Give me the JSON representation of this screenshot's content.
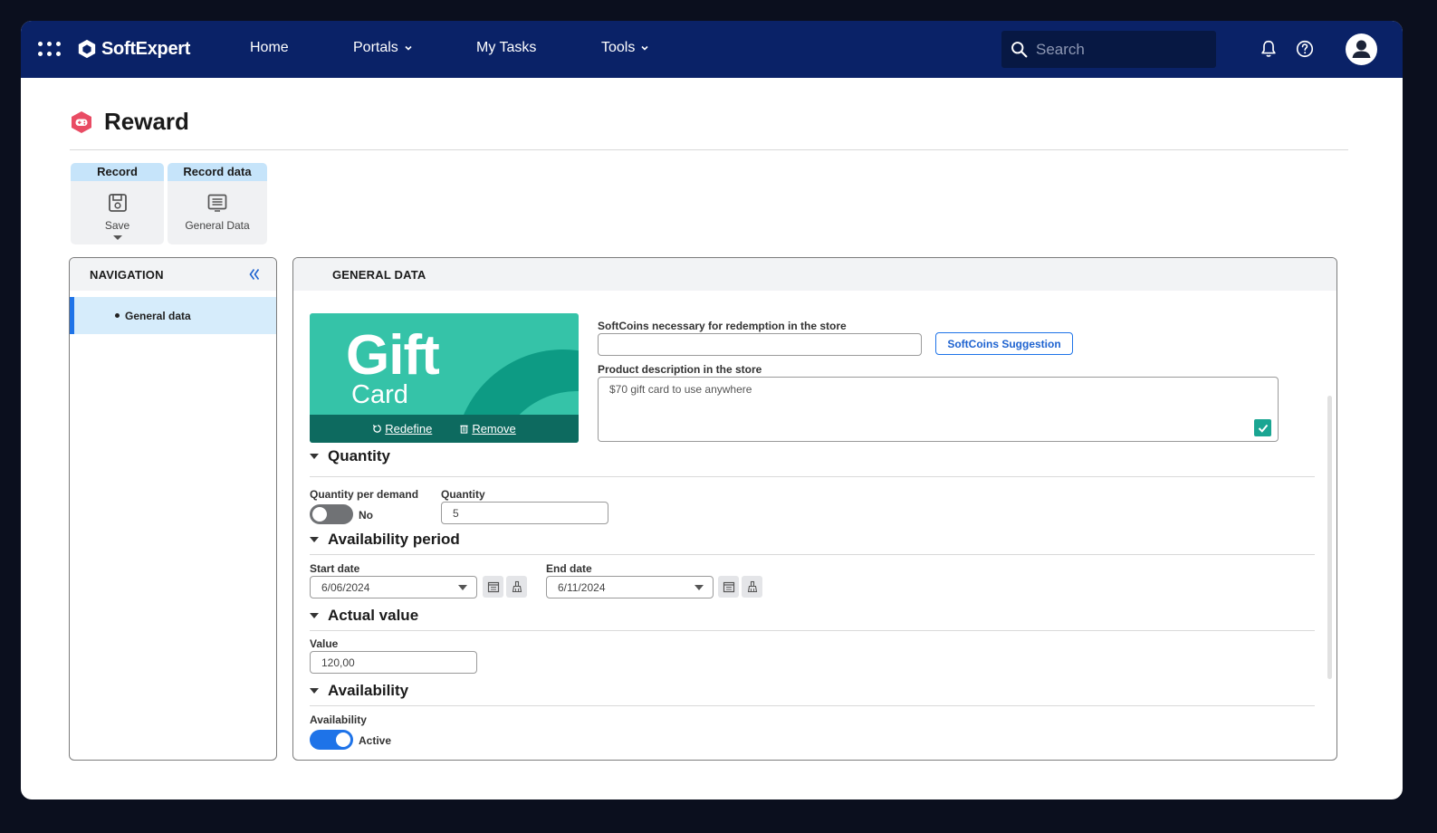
{
  "app": {
    "brand": "SoftExpert",
    "nav": {
      "home": "Home",
      "portals": "Portals",
      "my_tasks": "My Tasks",
      "tools": "Tools"
    },
    "search_placeholder": "Search"
  },
  "page": {
    "title": "Reward",
    "accent_color": "#e94c64"
  },
  "ribbon": {
    "record_group": "Record",
    "save_label": "Save",
    "record_data_group": "Record data",
    "general_data_label": "General Data"
  },
  "navigation": {
    "title": "NAVIGATION",
    "items": [
      {
        "label": "General data",
        "selected": true
      }
    ]
  },
  "general": {
    "title": "GENERAL DATA",
    "image": {
      "title": "Gift",
      "subtitle": "Card",
      "redefine": "Redefine",
      "remove": "Remove"
    },
    "softcoins_label": "SoftCoins necessary for redemption in the store",
    "softcoins_value": "",
    "suggestion_button": "SoftCoins Suggestion",
    "description_label": "Product description in the store",
    "description_value": "$70 gift card to use anywhere",
    "description_checked": true
  },
  "sections": {
    "quantity": {
      "title": "Quantity",
      "per_demand_label": "Quantity per demand",
      "per_demand_state": "No",
      "per_demand_on": false,
      "quantity_label": "Quantity",
      "quantity_value": "5"
    },
    "availability_period": {
      "title": "Availability period",
      "start_label": "Start date",
      "start_value": "6/06/2024",
      "end_label": "End date",
      "end_value": "6/11/2024"
    },
    "actual_value": {
      "title": "Actual value",
      "value_label": "Value",
      "value": "120,00"
    },
    "availability": {
      "title": "Availability",
      "label": "Availability",
      "state": "Active",
      "on": true
    }
  },
  "colors": {
    "topbar": "#0a2267",
    "accent_blue": "#1e73e8",
    "teal": "#35c3a8",
    "dark_teal": "#0d6a5f"
  }
}
